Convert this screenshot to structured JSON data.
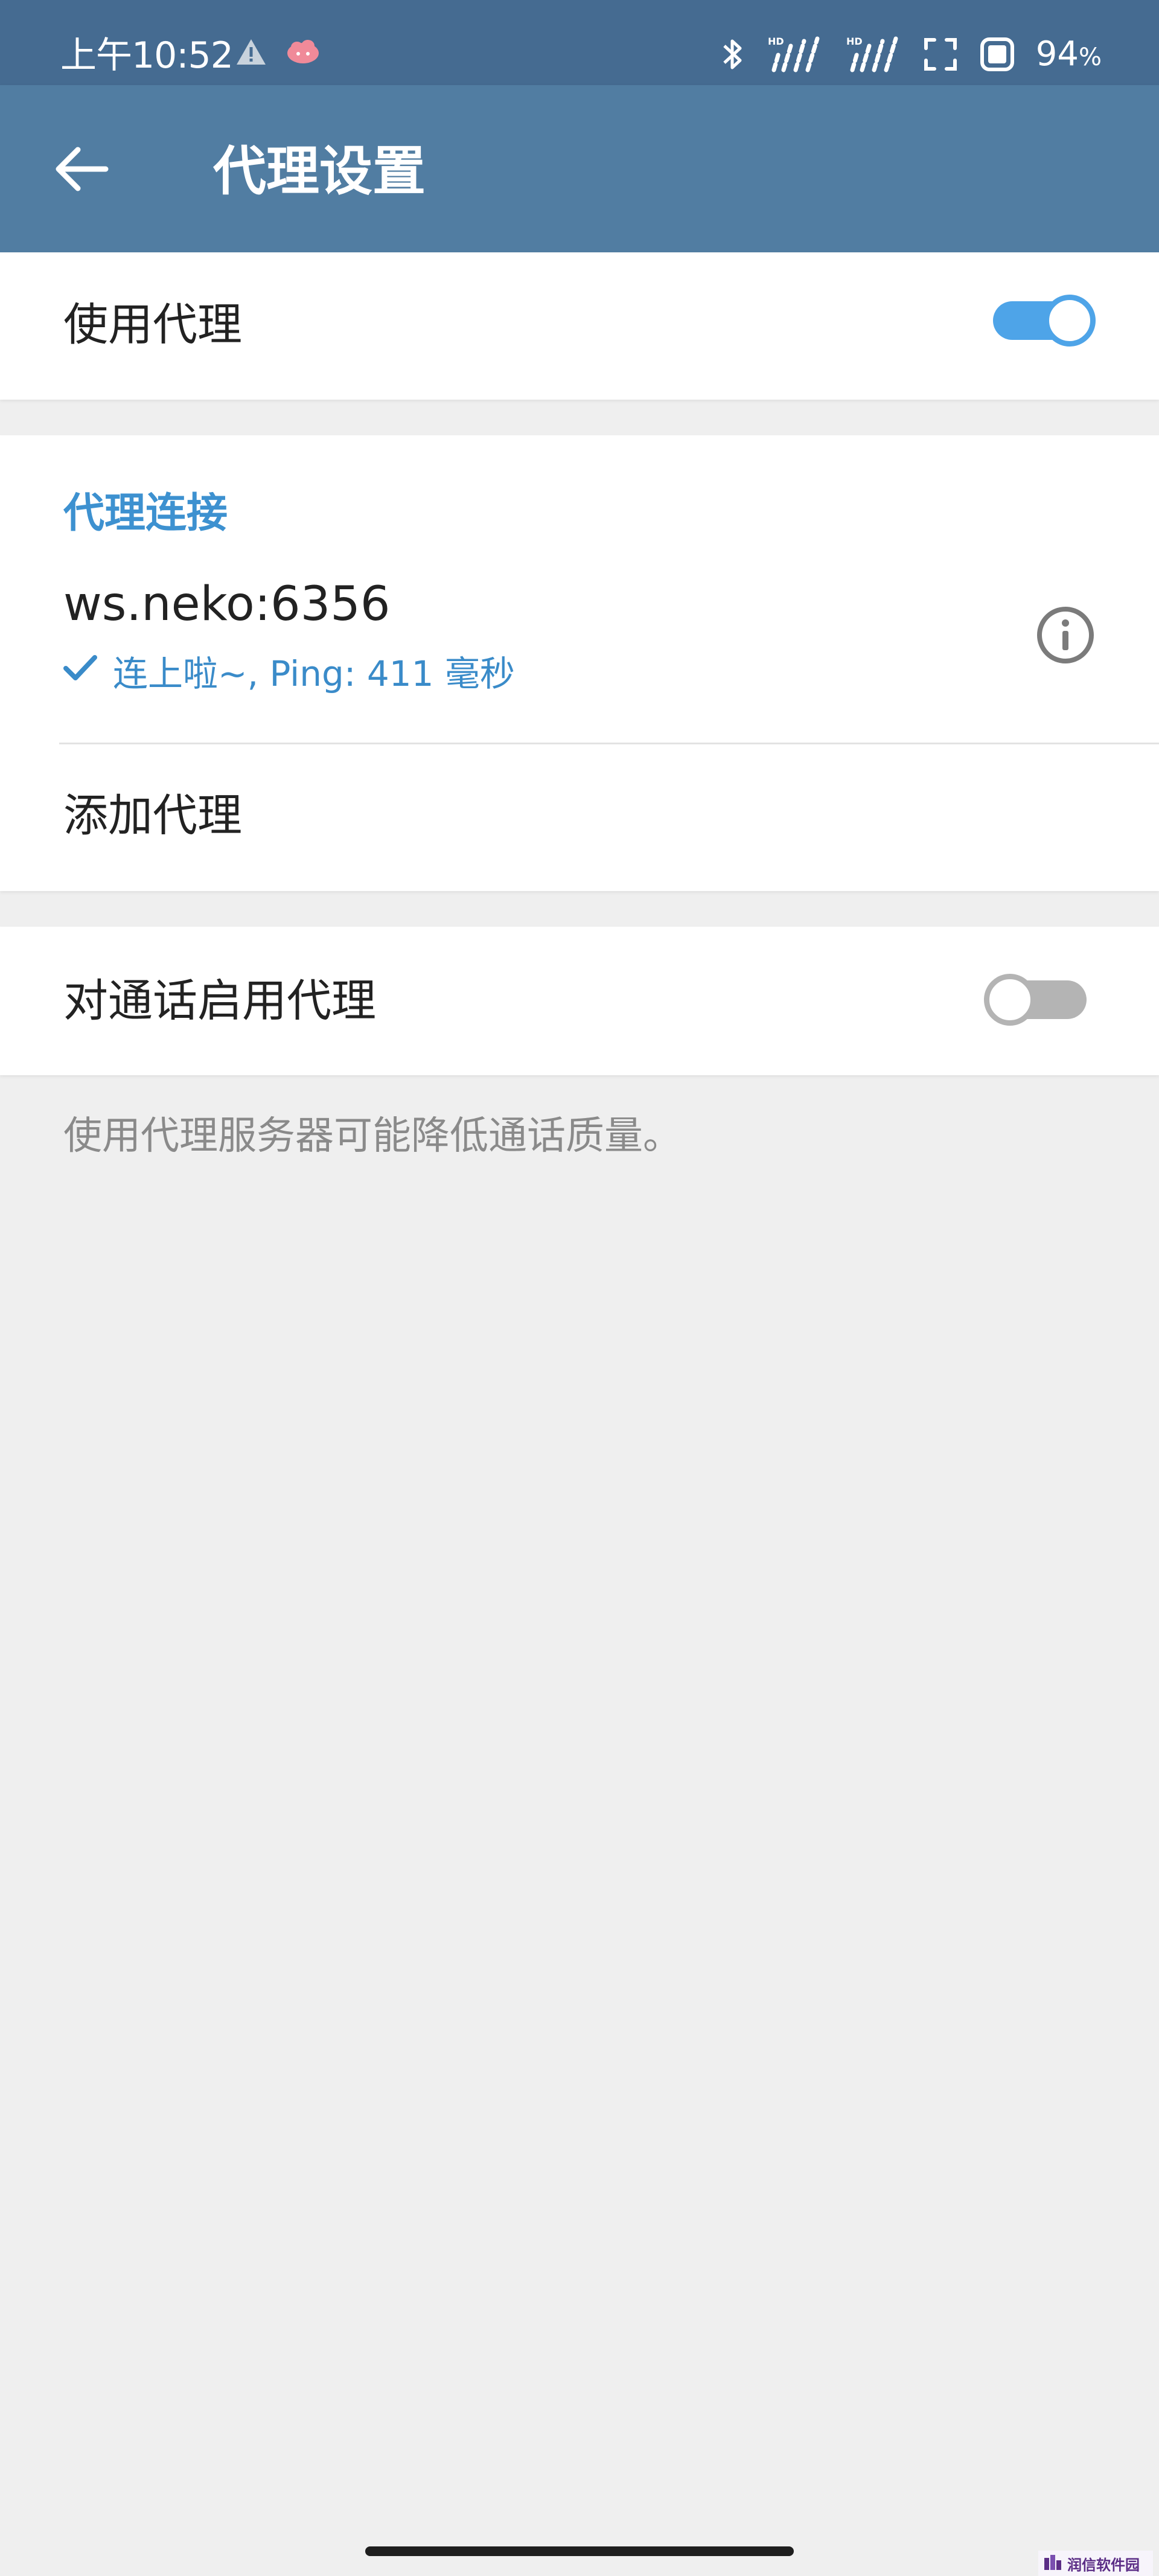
{
  "status_bar": {
    "time": "上午10:52",
    "left_icons": [
      "warning-icon",
      "cloud-app-icon"
    ],
    "right_icons": [
      "bluetooth-icon",
      "signal-hd-1-icon",
      "signal-hd-2-icon",
      "screen-capture-icon",
      "battery-icon"
    ],
    "battery_percent": "94",
    "battery_unit": "%"
  },
  "app_bar": {
    "title": "代理设置",
    "back_icon": "arrow-left-icon"
  },
  "use_proxy": {
    "label": "使用代理",
    "enabled": true
  },
  "proxy_connection": {
    "header": "代理连接",
    "proxy": {
      "address": "ws.neko:6356",
      "status": "连上啦~, Ping: 411 毫秒",
      "status_icon": "check-icon",
      "info_icon": "info-icon"
    },
    "add_label": "添加代理"
  },
  "call_proxy": {
    "label": "对通话启用代理",
    "enabled": false,
    "hint": "使用代理服务器可能降低通话质量。"
  },
  "colors": {
    "status_bar": "#456b91",
    "app_bar": "#517da2",
    "accent": "#4ea4e8",
    "background": "#efefef"
  },
  "watermark": {
    "text": "润信软件园"
  }
}
